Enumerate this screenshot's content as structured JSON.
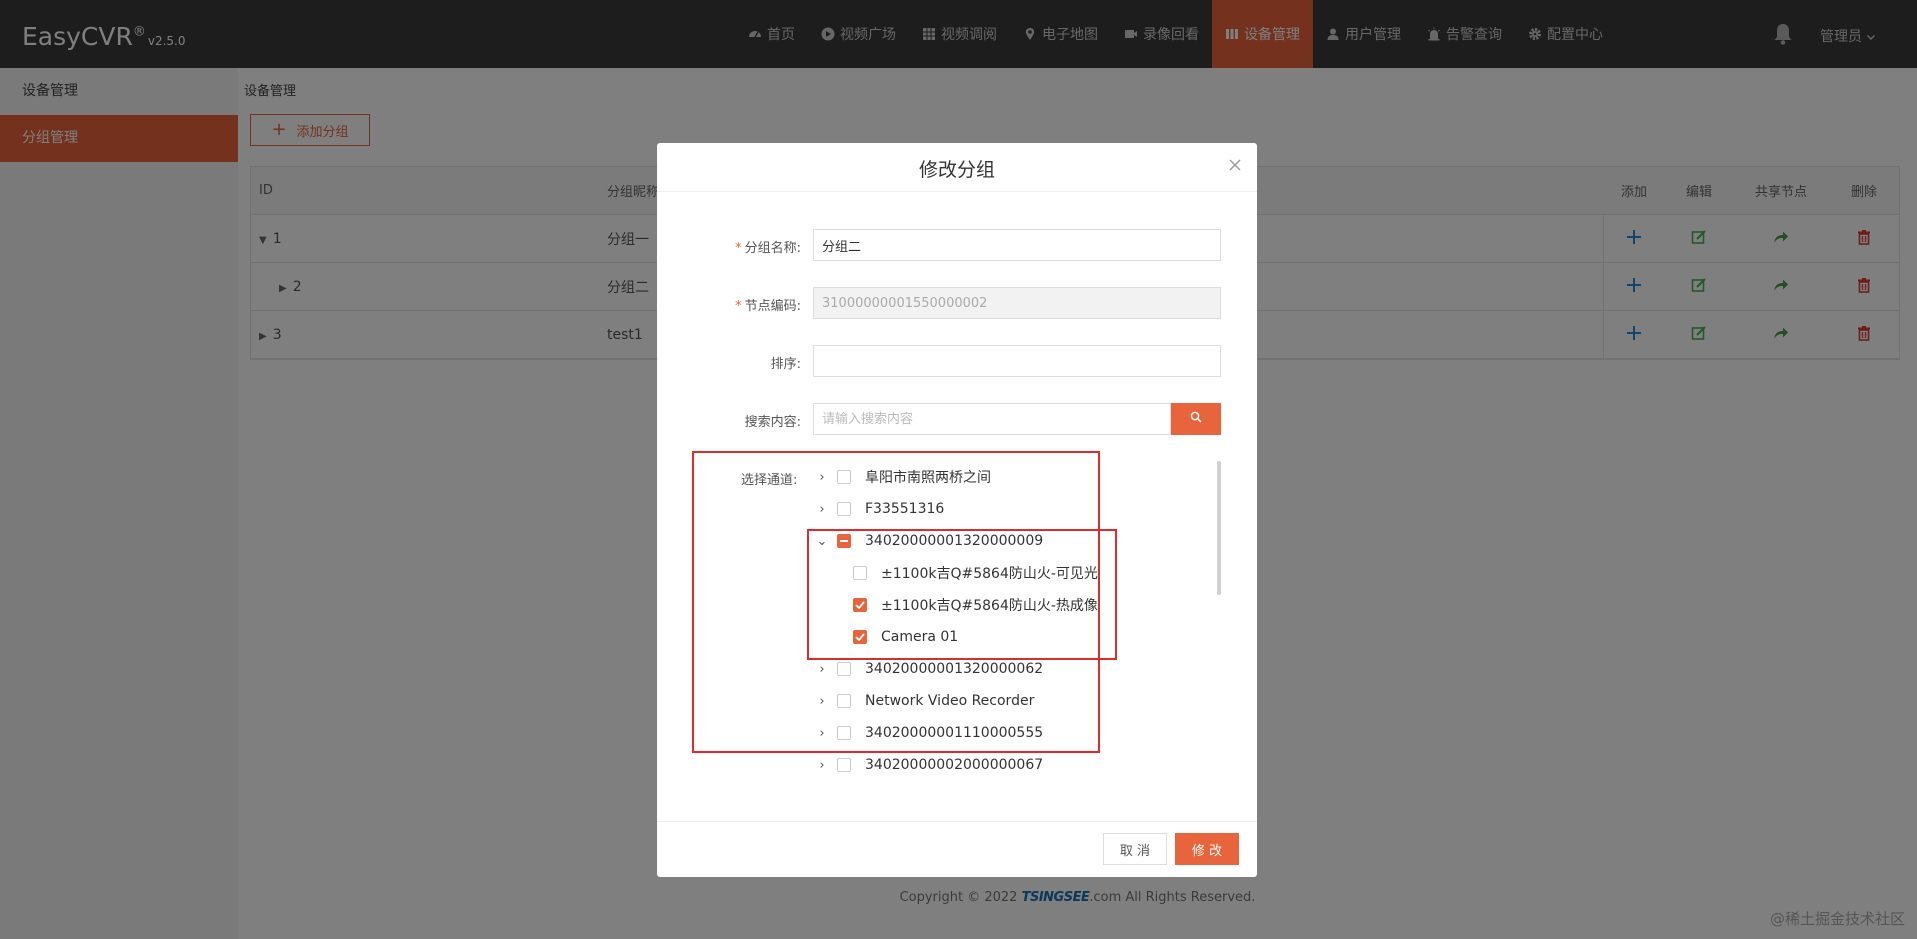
{
  "app": {
    "brand": "EasyCVR",
    "reg": "®",
    "version": "v2.5.0"
  },
  "nav": [
    {
      "label": "首页",
      "icon": "dashboard-icon"
    },
    {
      "label": "视频广场",
      "icon": "play-icon"
    },
    {
      "label": "视频调阅",
      "icon": "grid-icon"
    },
    {
      "label": "电子地图",
      "icon": "map-pin-icon"
    },
    {
      "label": "录像回看",
      "icon": "video-camera-icon"
    },
    {
      "label": "设备管理",
      "icon": "device-icon",
      "active": true
    },
    {
      "label": "用户管理",
      "icon": "user-icon"
    },
    {
      "label": "告警查询",
      "icon": "alarm-icon"
    },
    {
      "label": "配置中心",
      "icon": "gear-icon"
    }
  ],
  "user": {
    "name": "管理员"
  },
  "sidebar": {
    "items": [
      {
        "label": "设备管理"
      },
      {
        "label": "分组管理"
      }
    ]
  },
  "page": {
    "breadcrumb": "设备管理",
    "add_button": "添加分组"
  },
  "table": {
    "headers": {
      "id": "ID",
      "name": "分组昵称",
      "add": "添加",
      "edit": "编辑",
      "share": "共享节点",
      "delete": "删除"
    },
    "rows": [
      {
        "id": "1",
        "name": "分组一",
        "expanded": true
      },
      {
        "id": "2",
        "name": "分组二",
        "expanded": false
      },
      {
        "id": "3",
        "name": "test1",
        "expanded": false
      }
    ]
  },
  "dialog": {
    "title": "修改分组",
    "name_label": "分组名称:",
    "name_value": "分组二",
    "code_label": "节点编码:",
    "code_value": "31000000001550000002",
    "order_label": "排序:",
    "order_value": "",
    "search_label": "搜索内容:",
    "search_placeholder": "请输入搜索内容",
    "channel_label": "选择通道:",
    "tree": [
      {
        "label": "阜阳市南照两桥之间",
        "level": 0,
        "state": "unchecked",
        "arrow": "›"
      },
      {
        "label": "F33551316",
        "level": 0,
        "state": "unchecked",
        "arrow": "›"
      },
      {
        "label": "34020000001320000009",
        "level": 0,
        "state": "partial",
        "arrow": "⌄"
      },
      {
        "label": "±1100k吉Q#5864防山火-可见光",
        "level": 1,
        "state": "unchecked",
        "arrow": ""
      },
      {
        "label": "±1100k吉Q#5864防山火-热成像",
        "level": 1,
        "state": "checked",
        "arrow": ""
      },
      {
        "label": "Camera 01",
        "level": 1,
        "state": "checked",
        "arrow": ""
      },
      {
        "label": "34020000001320000062",
        "level": 0,
        "state": "unchecked",
        "arrow": "›"
      },
      {
        "label": "Network Video Recorder",
        "level": 0,
        "state": "unchecked",
        "arrow": "›"
      },
      {
        "label": "34020000001110000555",
        "level": 0,
        "state": "unchecked",
        "arrow": "›"
      },
      {
        "label": "34020000002000000067",
        "level": 0,
        "state": "unchecked",
        "arrow": "›"
      }
    ],
    "cancel_label": "取 消",
    "confirm_label": "修 改"
  },
  "footer": {
    "prefix": "Copyright © 2022 ",
    "brand": "TSINGSEE",
    "suffix": ".com All Rights Reserved."
  },
  "watermark": "@稀土掘金技术社区",
  "colors": {
    "accent": "#e8643c",
    "topbar": "#3a3a3a",
    "add_icon": "#1d8ce0",
    "edit_icon": "#4caf50",
    "share_icon": "#43a047",
    "delete_icon": "#e53935",
    "highlight": "#e02b2b"
  }
}
